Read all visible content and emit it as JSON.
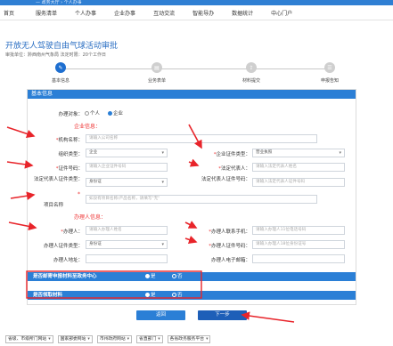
{
  "header": {
    "crumbs": "— 政务大厅  › 个人办事",
    "nav": [
      "首页",
      "服务清单",
      "个人办事",
      "企业办事",
      "互动交流",
      "智能导办",
      "数据统计",
      "中心门户"
    ]
  },
  "page": {
    "title": "开放无人驾驶自由气球活动审批",
    "subtitle": "审批单位：黔西南州气象局      法定时限：20个工作日"
  },
  "steps": [
    {
      "label": "基本信息",
      "icon": "edit-icon",
      "active": true
    },
    {
      "label": "业务表单",
      "icon": "form-icon",
      "active": false
    },
    {
      "label": "材料提交",
      "icon": "upload-icon",
      "active": false
    },
    {
      "label": "申报告知",
      "icon": "notice-icon",
      "active": false
    }
  ],
  "form": {
    "section_title": "基本信息",
    "applicant_type": {
      "label": "办理对象：",
      "options": [
        "个人",
        "企业"
      ],
      "selected": "企业"
    },
    "company_heading": "企业信息：",
    "org_name": {
      "label": "机构名称：",
      "placeholder": "请输入公司名称"
    },
    "org_type": {
      "label": "组织类型：",
      "value": "企业"
    },
    "company_id_type": {
      "label": "企业证件类型：",
      "value": "营业执照"
    },
    "id_number": {
      "label": "证件号码：",
      "placeholder": "请输入企业证件号码"
    },
    "legal_rep": {
      "label": "法定代表人：",
      "placeholder": "请输入法定代表人姓名"
    },
    "legal_id_type": {
      "label": "法定代表人证件类型：",
      "value": "身份证"
    },
    "legal_id_number": {
      "label": "法定代表人证件号码：",
      "placeholder": "请输入法定代表人证件号码"
    },
    "project_name": {
      "label": "项目名称",
      "placeholder": "如没有项目名称/产品名称，请填写\"无\""
    },
    "agent_heading": "办理人信息：",
    "agent_name": {
      "label": "办理人：",
      "placeholder": "请输入办理人姓名"
    },
    "agent_phone": {
      "label": "办理人联系手机：",
      "placeholder": "请输入办理人11位电话号码"
    },
    "agent_id_type": {
      "label": "办理人证件类型：",
      "value": "身份证"
    },
    "agent_id_number": {
      "label": "办理人证件号码：",
      "placeholder": "请输入办理人18位身份证号"
    },
    "agent_address": {
      "label": "办理人地址：",
      "placeholder": ""
    },
    "agent_email": {
      "label": "办理人电子邮箱：",
      "placeholder": ""
    },
    "mail_to_center": {
      "label": "是否邮寄申报材料至政务中心",
      "yes": "是",
      "no": "否",
      "selected": "是"
    },
    "receive_materials": {
      "label": "是否领取材料",
      "yes": "是",
      "no": "否",
      "selected": "是"
    }
  },
  "buttons": {
    "prev": "返回",
    "next": "下一步"
  },
  "footer": {
    "selects": [
      "省级、市级所门网站",
      "国家部委网站",
      "市州政府网站",
      "省直部门",
      "各省政务服务平台"
    ]
  },
  "colors": {
    "primary": "#2b7fd6",
    "annotation": "#e8242a",
    "required": "#e33333"
  }
}
